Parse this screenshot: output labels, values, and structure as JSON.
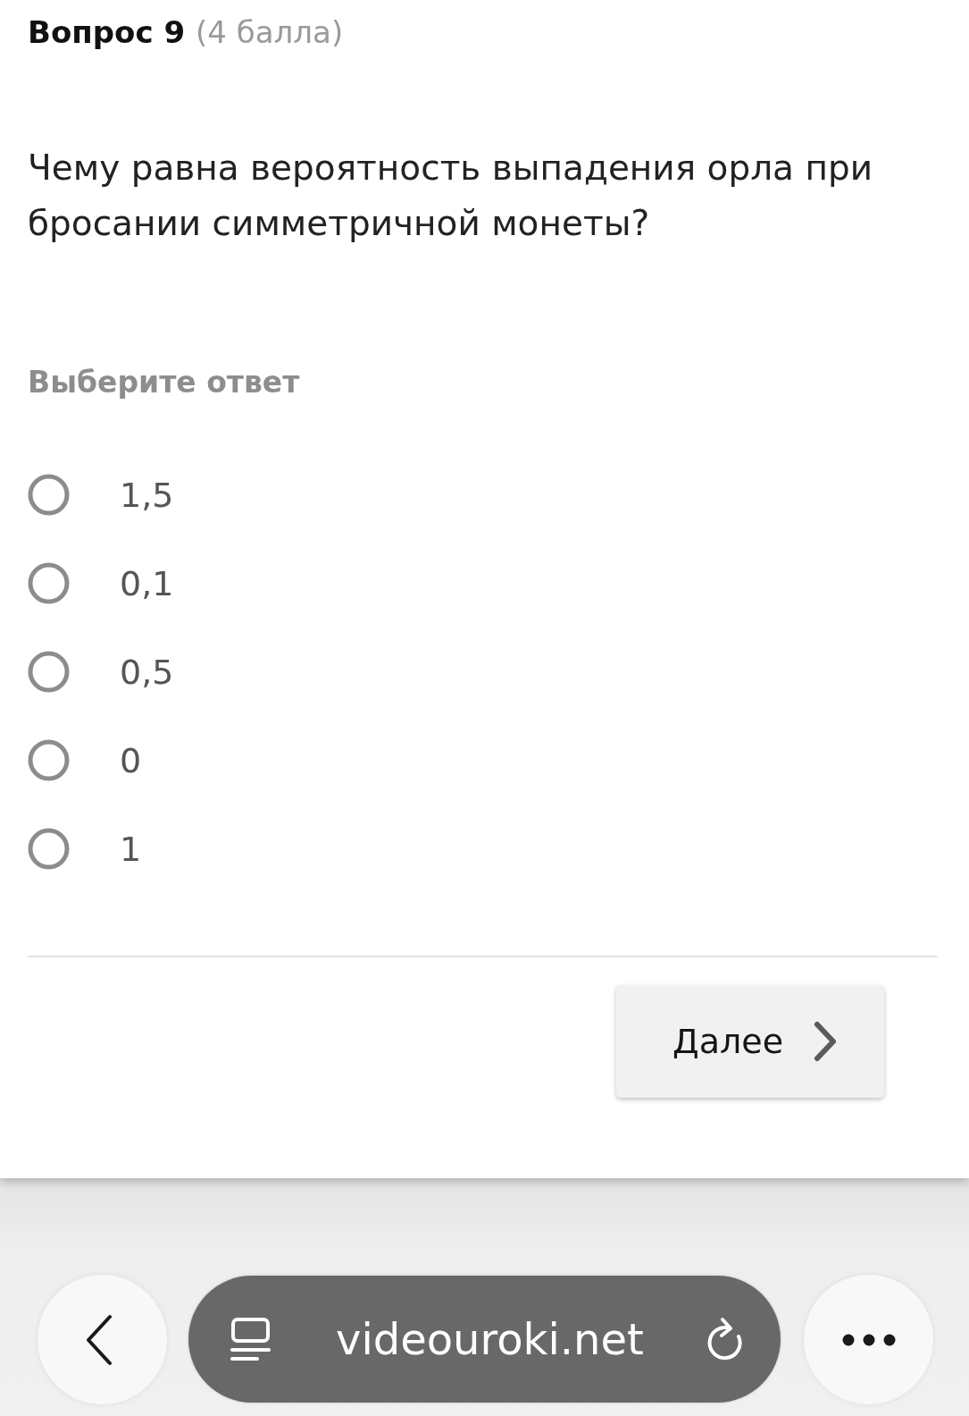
{
  "question": {
    "title": "Вопрос 9",
    "points": "(4 балла)",
    "text": "Чему равна вероятность выпадения орла при бросании симметричной монеты?"
  },
  "answer_prompt": "Выберите ответ",
  "options": [
    {
      "label": "1,5",
      "selected": false
    },
    {
      "label": "0,1",
      "selected": false
    },
    {
      "label": "0,5",
      "selected": false
    },
    {
      "label": "0",
      "selected": false
    },
    {
      "label": "1",
      "selected": false
    }
  ],
  "next_button": {
    "label": "Далее"
  },
  "browser_bar": {
    "url": "videouroki.net"
  }
}
